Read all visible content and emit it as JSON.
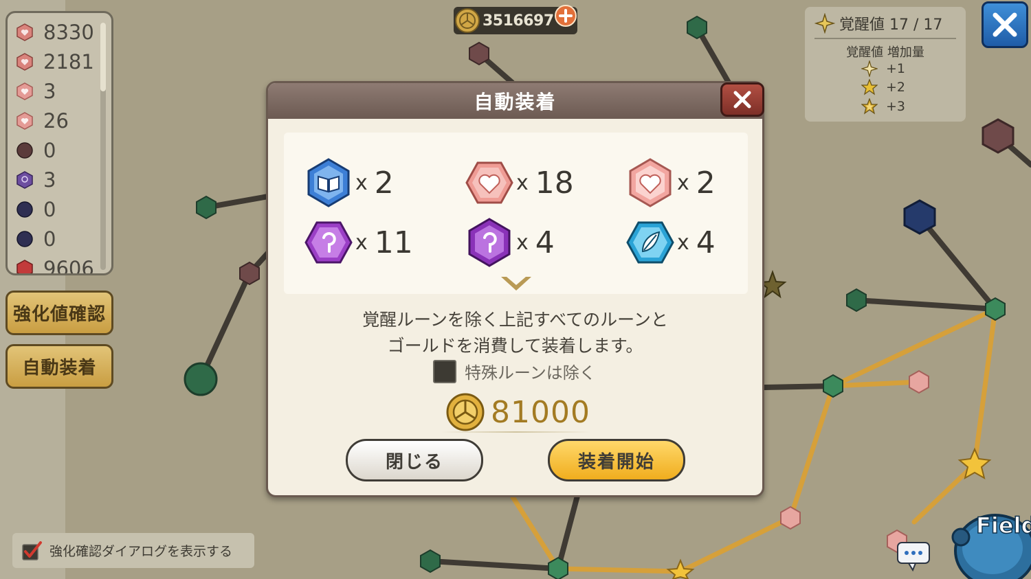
{
  "inventory": {
    "items": [
      {
        "icon": "heart-rune-icon",
        "count": "8330",
        "color": "#d9837c"
      },
      {
        "icon": "heart-rune-icon",
        "count": "2181",
        "color": "#d9837c"
      },
      {
        "icon": "heart-rune-icon",
        "count": "3",
        "color": "#e49b96"
      },
      {
        "icon": "heart-rune-icon",
        "count": "26",
        "color": "#e49b96"
      },
      {
        "icon": "dark-rune-icon",
        "count": "0",
        "color": "#5b3b3b"
      },
      {
        "icon": "purple-rune-icon",
        "count": "3",
        "color": "#6d4ea0"
      },
      {
        "icon": "dark-blue-rune-icon",
        "count": "0",
        "color": "#2f2f52"
      },
      {
        "icon": "dark-blue-rune-icon",
        "count": "0",
        "color": "#2f2f52"
      },
      {
        "icon": "red-rune-icon",
        "count": "9606",
        "color": "#c23b3b"
      }
    ]
  },
  "side_buttons": {
    "enhance_check": "強化値確認",
    "auto_equip": "自動装着"
  },
  "confirm_toggle": {
    "checked": true,
    "label": "強化確認ダイアログを表示する"
  },
  "top_gold": {
    "value": "3516697"
  },
  "awaken": {
    "title": "覚醒値 17 / 17",
    "subtitle": "覚醒値 増加量",
    "rows": [
      {
        "icon": "star-outline-icon",
        "label": "+1"
      },
      {
        "icon": "star-gold-icon",
        "label": "+2"
      },
      {
        "icon": "star-double-icon",
        "label": "+3"
      }
    ]
  },
  "field_button": {
    "label": "Field"
  },
  "dialog": {
    "title": "自動装着",
    "runes": [
      {
        "icon": "blue-book-rune-icon",
        "x": "x",
        "count": "2"
      },
      {
        "icon": "pink-heart-rune-icon",
        "x": "x",
        "count": "18"
      },
      {
        "icon": "light-heart-rune-icon",
        "x": "x",
        "count": "2"
      },
      {
        "icon": "purple-swirl-rune-icon",
        "x": "x",
        "count": "11"
      },
      {
        "icon": "violet-swirl-rune-icon",
        "x": "x",
        "count": "4"
      },
      {
        "icon": "cyan-leaf-rune-icon",
        "x": "x",
        "count": "4"
      }
    ],
    "description_line1": "覚醒ルーンを除く上記すべてのルーンと",
    "description_line2": "ゴールドを消費して装着します。",
    "special_exclude_label": "特殊ルーンは除く",
    "cost": "81000",
    "close_label": "閉じる",
    "equip_label": "装着開始"
  },
  "colors": {
    "dialog_header": "#7a6860",
    "gold_button": "#f5b630",
    "blue_close": "#2f74c4",
    "map_background": "#a79f86"
  }
}
